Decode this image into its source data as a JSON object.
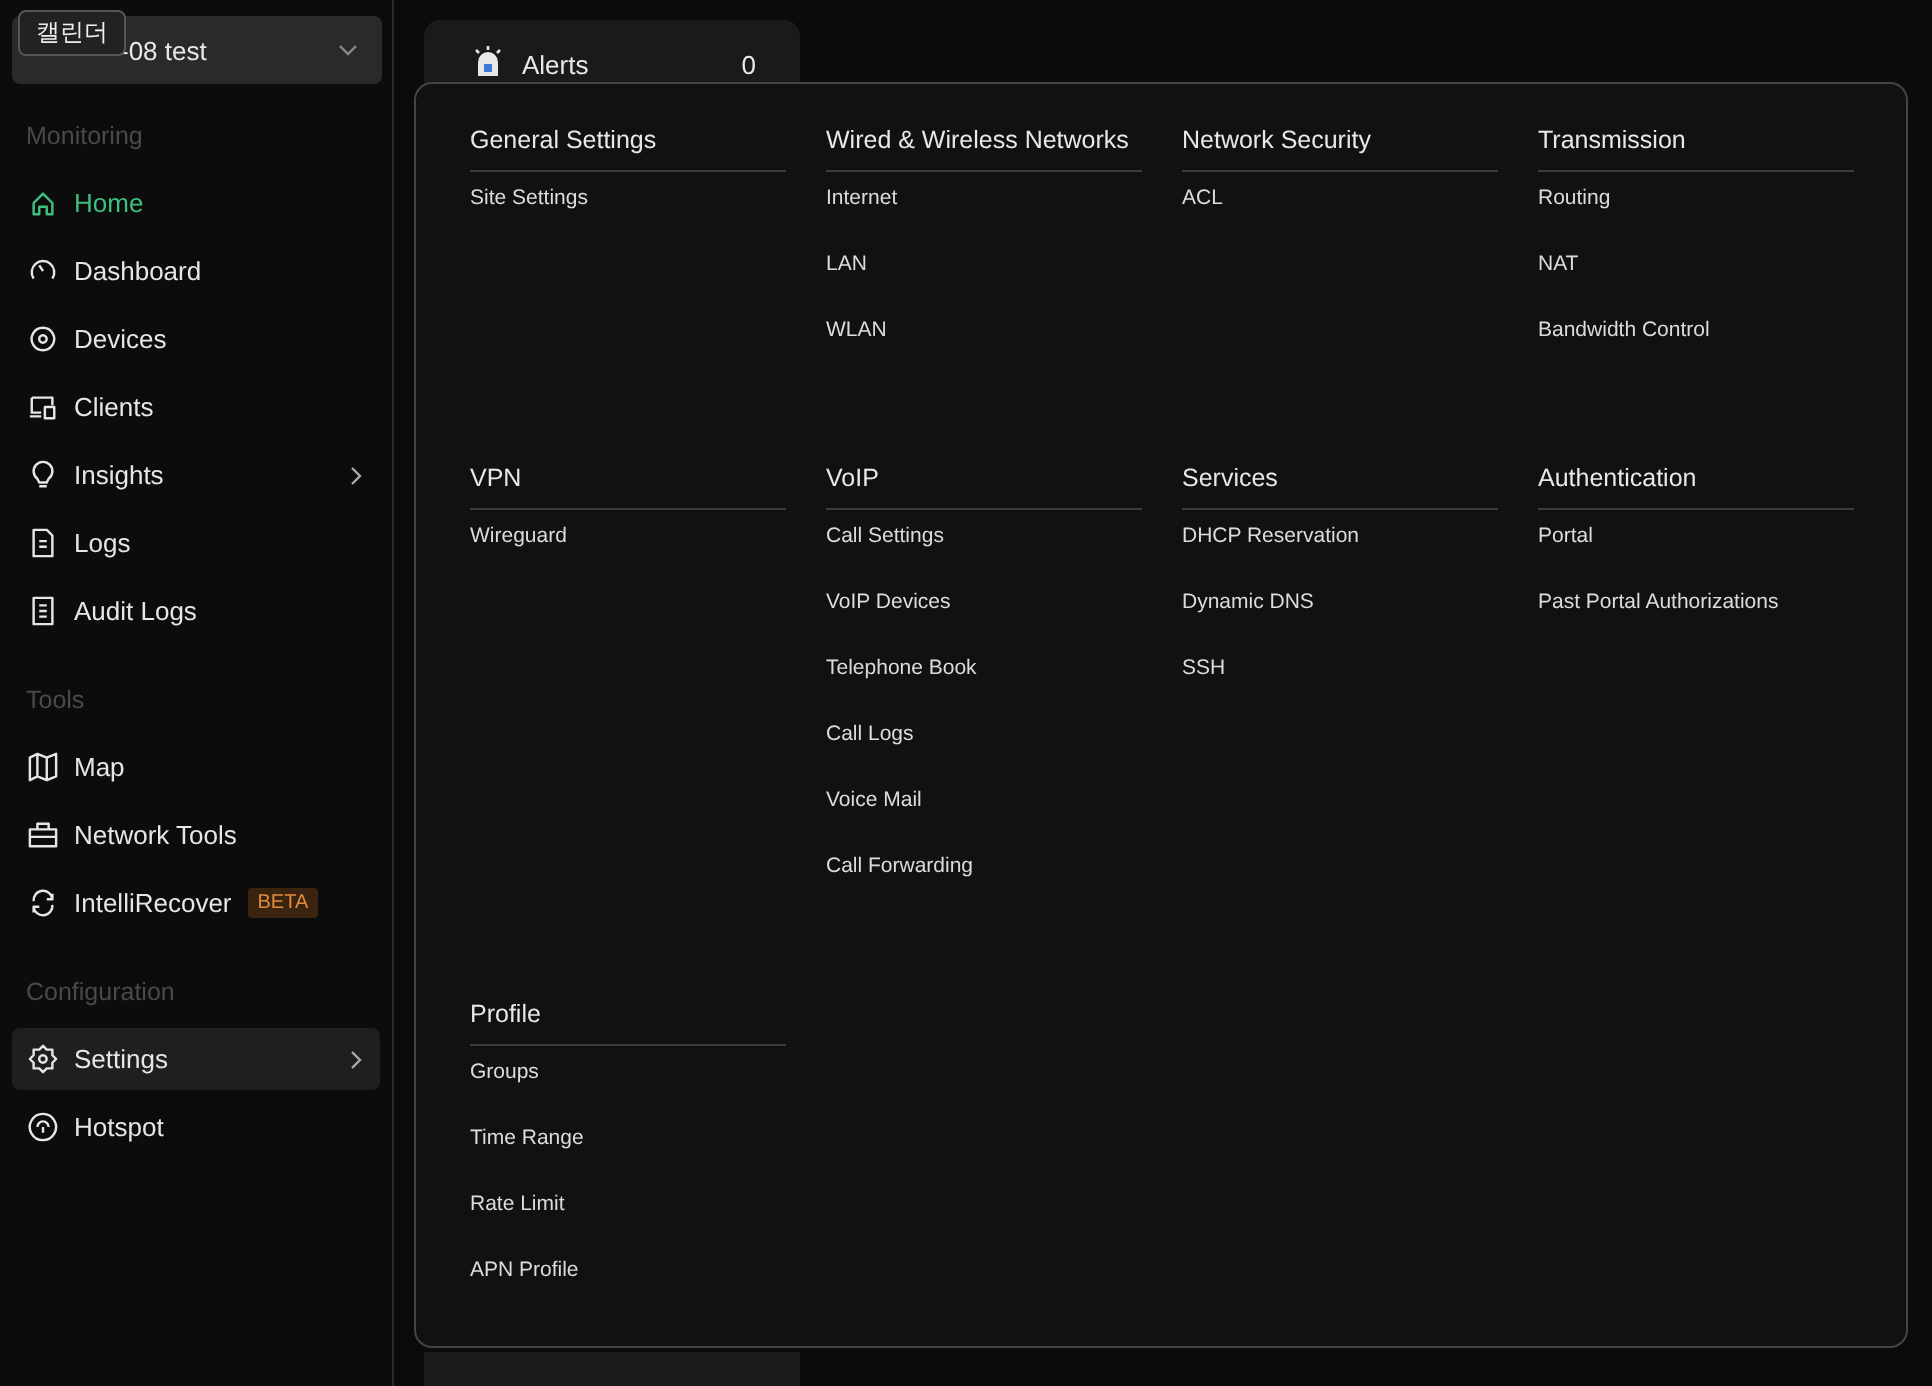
{
  "tooltip": {
    "text": "캘린더"
  },
  "site_selector": {
    "value": "-08 test"
  },
  "sidebar": {
    "groups": [
      {
        "label": "Monitoring",
        "items": [
          {
            "label": "Home",
            "selected": true,
            "has_submenu": false
          },
          {
            "label": "Dashboard",
            "selected": false,
            "has_submenu": false
          },
          {
            "label": "Devices",
            "selected": false,
            "has_submenu": false
          },
          {
            "label": "Clients",
            "selected": false,
            "has_submenu": false
          },
          {
            "label": "Insights",
            "selected": false,
            "has_submenu": true
          },
          {
            "label": "Logs",
            "selected": false,
            "has_submenu": false
          },
          {
            "label": "Audit Logs",
            "selected": false,
            "has_submenu": false
          }
        ]
      },
      {
        "label": "Tools",
        "items": [
          {
            "label": "Map",
            "selected": false,
            "has_submenu": false
          },
          {
            "label": "Network Tools",
            "selected": false,
            "has_submenu": false
          },
          {
            "label": "IntelliRecover",
            "selected": false,
            "has_submenu": false,
            "badge": "BETA"
          }
        ]
      },
      {
        "label": "Configuration",
        "items": [
          {
            "label": "Settings",
            "selected": false,
            "highlighted": true,
            "has_submenu": true
          },
          {
            "label": "Hotspot",
            "selected": false,
            "has_submenu": false
          }
        ]
      }
    ]
  },
  "alerts_card": {
    "label": "Alerts",
    "count": "0"
  },
  "settings_menu": {
    "sections": [
      {
        "title": "General Settings",
        "items": [
          "Site Settings"
        ]
      },
      {
        "title": "Wired & Wireless Networks",
        "items": [
          "Internet",
          "LAN",
          "WLAN"
        ]
      },
      {
        "title": "Network Security",
        "items": [
          "ACL"
        ]
      },
      {
        "title": "Transmission",
        "items": [
          "Routing",
          "NAT",
          "Bandwidth Control"
        ]
      },
      {
        "title": "VPN",
        "items": [
          "Wireguard"
        ]
      },
      {
        "title": "VoIP",
        "items": [
          "Call Settings",
          "VoIP Devices",
          "Telephone Book",
          "Call Logs",
          "Voice Mail",
          "Call Forwarding"
        ]
      },
      {
        "title": "Services",
        "items": [
          "DHCP Reservation",
          "Dynamic DNS",
          "SSH"
        ]
      },
      {
        "title": "Authentication",
        "items": [
          "Portal",
          "Past Portal Authorizations"
        ]
      },
      {
        "title": "Profile",
        "items": [
          "Groups",
          "Time Range",
          "Rate Limit",
          "APN Profile"
        ]
      }
    ]
  }
}
